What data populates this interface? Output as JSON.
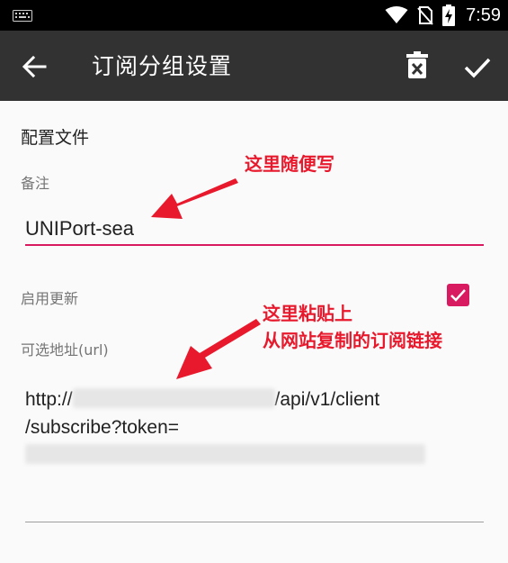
{
  "status_bar": {
    "time": "7:59",
    "icons": [
      "keyboard-icon",
      "wifi-icon",
      "no-sim-icon",
      "battery-charging-icon"
    ]
  },
  "app_bar": {
    "title": "订阅分组设置",
    "back_icon": "back-arrow-icon",
    "delete_icon": "delete-icon",
    "confirm_icon": "check-icon"
  },
  "form": {
    "section_title": "配置文件",
    "remark_label": "备注",
    "remark_value": "UNIPort-sea",
    "enable_update_label": "启用更新",
    "enable_update_checked": true,
    "url_label": "可选地址(url)",
    "url_prefix": "http://",
    "url_middle": "/api/v1/client",
    "url_line2": "/subscribe?token="
  },
  "annotations": {
    "note1": "这里随便写",
    "note2_line1": "这里粘贴上",
    "note2_line2": "从网站复制的订阅链接"
  },
  "colors": {
    "accent": "#d81b60",
    "annotation": "#e8192c",
    "app_bar": "#323232",
    "status_bar": "#000000"
  }
}
